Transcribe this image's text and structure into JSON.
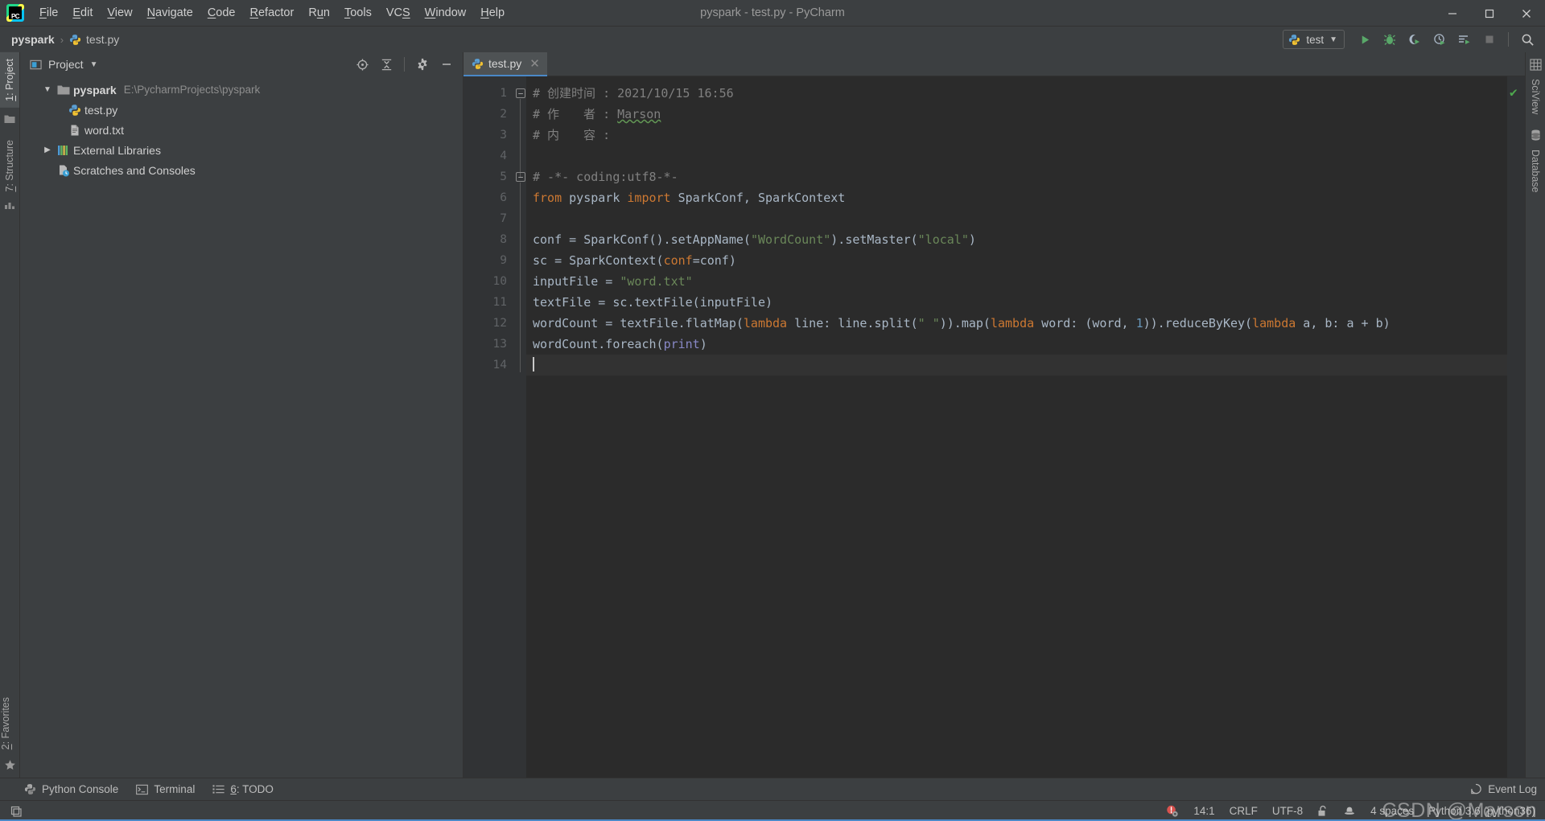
{
  "window": {
    "title": "pyspark - test.py - PyCharm",
    "app_icon": "pycharm-logo-icon",
    "logo_text": "PC",
    "controls": {
      "minimize": "─",
      "maximize": "❐",
      "close": "✕"
    }
  },
  "menubar": {
    "items": [
      {
        "label": "File",
        "mnemonic": "F"
      },
      {
        "label": "Edit",
        "mnemonic": "E"
      },
      {
        "label": "View",
        "mnemonic": "V"
      },
      {
        "label": "Navigate",
        "mnemonic": "N"
      },
      {
        "label": "Code",
        "mnemonic": "C"
      },
      {
        "label": "Refactor",
        "mnemonic": "R"
      },
      {
        "label": "Run",
        "mnemonic": "u"
      },
      {
        "label": "Tools",
        "mnemonic": "T"
      },
      {
        "label": "VCS",
        "mnemonic": "S"
      },
      {
        "label": "Window",
        "mnemonic": "W"
      },
      {
        "label": "Help",
        "mnemonic": "H"
      }
    ]
  },
  "navbar": {
    "breadcrumbs": [
      {
        "label": "pyspark",
        "icon": ""
      },
      {
        "label": "test.py",
        "icon": "python-file-icon"
      }
    ],
    "separator": "›",
    "run_config": {
      "label": "test",
      "icon": "python-config-icon",
      "dropdown": "▾"
    },
    "buttons": [
      {
        "name": "run-button",
        "icon": "run-triangle-icon",
        "color": "#59a869"
      },
      {
        "name": "debug-button",
        "icon": "debug-bug-icon",
        "color": "#59a869"
      },
      {
        "name": "run-with-coverage-button",
        "icon": "coverage-icon",
        "color": "#59a869"
      },
      {
        "name": "profile-button",
        "icon": "profiler-clock-icon",
        "color": "#59a869"
      },
      {
        "name": "run-with-console-button",
        "icon": "run-list-icon",
        "color": "#59a869"
      },
      {
        "name": "stop-button",
        "icon": "stop-square-icon",
        "color": "#6e6e6e"
      },
      {
        "name": "search-everywhere-button",
        "icon": "search-icon",
        "color": "#c4c4c4"
      }
    ]
  },
  "left_strip": {
    "tabs": [
      {
        "label": "1: Project",
        "mnemonic": "1",
        "icon": "project-folder-icon",
        "active": true
      },
      {
        "label": "7: Structure",
        "mnemonic": "7",
        "icon": "structure-icon",
        "active": false
      }
    ],
    "bottom_tabs": [
      {
        "label": "2: Favorites",
        "mnemonic": "2",
        "icon": "star-icon",
        "active": false
      }
    ]
  },
  "right_strip": {
    "tabs": [
      {
        "label": "SciView",
        "icon": "grid-table-icon"
      },
      {
        "label": "Database",
        "icon": "database-cylinder-icon"
      }
    ]
  },
  "project_panel": {
    "title": "Project",
    "dropdown": "▾",
    "view_icon": "project-view-icon",
    "toolbar": [
      {
        "name": "select-opened-file-button",
        "icon": "crosshair-target-icon"
      },
      {
        "name": "collapse-all-button",
        "icon": "collapse-all-icon"
      },
      {
        "name": "settings-button",
        "icon": "gear-icon"
      },
      {
        "name": "hide-button",
        "icon": "minimize-dash-icon"
      }
    ],
    "tree": [
      {
        "label": "pyspark",
        "secondary": "E:\\PycharmProjects\\pyspark",
        "icon": "folder-icon",
        "arrow": "▾",
        "indent": 1,
        "bold": true
      },
      {
        "label": "test.py",
        "secondary": "",
        "icon": "python-file-icon",
        "arrow": "",
        "indent": 2,
        "bold": false
      },
      {
        "label": "word.txt",
        "secondary": "",
        "icon": "text-file-icon",
        "arrow": "",
        "indent": 2,
        "bold": false
      },
      {
        "label": "External Libraries",
        "secondary": "",
        "icon": "libraries-icon",
        "arrow": "▸",
        "indent": 1,
        "bold": false
      },
      {
        "label": "Scratches and Consoles",
        "secondary": "",
        "icon": "scratches-icon",
        "arrow": "",
        "indent": 1,
        "bold": false
      }
    ]
  },
  "editor": {
    "tabs": [
      {
        "label": "test.py",
        "icon": "python-file-icon",
        "close": "✕",
        "active": true
      }
    ],
    "inspection_status": "✔",
    "line_numbers": [
      1,
      2,
      3,
      4,
      5,
      6,
      7,
      8,
      9,
      10,
      11,
      12,
      13,
      14
    ],
    "lines": [
      {
        "n": 1,
        "tokens": [
          {
            "t": "# 创建时间 : 2021/10/15 16:56",
            "c": "cm"
          }
        ]
      },
      {
        "n": 2,
        "tokens": [
          {
            "t": "# 作　　者 : ",
            "c": "cm"
          },
          {
            "t": "Marson",
            "c": "cm typo"
          }
        ]
      },
      {
        "n": 3,
        "tokens": [
          {
            "t": "# 内　　容 :",
            "c": "cm"
          }
        ]
      },
      {
        "n": 4,
        "tokens": []
      },
      {
        "n": 5,
        "tokens": [
          {
            "t": "# -*- coding:utf8-*-",
            "c": "cm"
          }
        ]
      },
      {
        "n": 6,
        "tokens": [
          {
            "t": "from",
            "c": "kw"
          },
          {
            "t": " pyspark ",
            "c": "txt"
          },
          {
            "t": "import",
            "c": "kw"
          },
          {
            "t": " SparkConf, SparkContext",
            "c": "txt"
          }
        ]
      },
      {
        "n": 7,
        "tokens": []
      },
      {
        "n": 8,
        "tokens": [
          {
            "t": "conf = SparkConf().setAppName(",
            "c": "txt"
          },
          {
            "t": "\"WordCount\"",
            "c": "str"
          },
          {
            "t": ").setMaster(",
            "c": "txt"
          },
          {
            "t": "\"local\"",
            "c": "str"
          },
          {
            "t": ")",
            "c": "txt"
          }
        ]
      },
      {
        "n": 9,
        "tokens": [
          {
            "t": "sc = SparkContext(",
            "c": "txt"
          },
          {
            "t": "conf",
            "c": "kw"
          },
          {
            "t": "=conf)",
            "c": "txt"
          }
        ]
      },
      {
        "n": 10,
        "tokens": [
          {
            "t": "inputFile = ",
            "c": "txt"
          },
          {
            "t": "\"word.txt\"",
            "c": "str"
          }
        ]
      },
      {
        "n": 11,
        "tokens": [
          {
            "t": "textFile = sc.textFile(inputFile)",
            "c": "txt"
          }
        ]
      },
      {
        "n": 12,
        "tokens": [
          {
            "t": "wordCount = textFile.flatMap(",
            "c": "txt"
          },
          {
            "t": "lambda",
            "c": "kw"
          },
          {
            "t": " line: line.split(",
            "c": "txt"
          },
          {
            "t": "\" \"",
            "c": "str"
          },
          {
            "t": ")).map(",
            "c": "txt"
          },
          {
            "t": "lambda",
            "c": "kw"
          },
          {
            "t": " word: (word, ",
            "c": "txt"
          },
          {
            "t": "1",
            "c": "num"
          },
          {
            "t": ")).reduceByKey(",
            "c": "txt"
          },
          {
            "t": "lambda",
            "c": "kw"
          },
          {
            "t": " a, b: a + b)",
            "c": "txt"
          }
        ]
      },
      {
        "n": 13,
        "tokens": [
          {
            "t": "wordCount.foreach(",
            "c": "txt"
          },
          {
            "t": "print",
            "c": "bi"
          },
          {
            "t": ")",
            "c": "txt"
          }
        ]
      },
      {
        "n": 14,
        "tokens": [],
        "caret": true
      }
    ]
  },
  "bottom_bar": {
    "buttons": [
      {
        "label": "Python Console",
        "icon": "python-console-icon",
        "mnemonic": ""
      },
      {
        "label": "Terminal",
        "icon": "terminal-icon",
        "mnemonic": ""
      },
      {
        "label": "6: TODO",
        "icon": "todo-list-icon",
        "mnemonic": "6"
      }
    ],
    "right": {
      "label": "Event Log",
      "icon": "event-log-icon"
    }
  },
  "status_bar": {
    "left_icon": "show-toolwindow-bars-icon",
    "items": [
      {
        "name": "inspection-error-badge",
        "label": "",
        "icon": "error-gear-icon"
      },
      {
        "name": "caret-position",
        "label": "14:1",
        "icon": ""
      },
      {
        "name": "line-separator",
        "label": "CRLF",
        "icon": ""
      },
      {
        "name": "file-encoding",
        "label": "UTF-8",
        "icon": ""
      },
      {
        "name": "lock-status",
        "label": "",
        "icon": "unlock-icon"
      },
      {
        "name": "git-branch",
        "label": "",
        "icon": "hat-icon"
      },
      {
        "name": "indent-size",
        "label": "4 spaces",
        "icon": ""
      },
      {
        "name": "python-interpreter",
        "label": "Python 3.6 (python36)",
        "icon": ""
      }
    ]
  },
  "watermark": {
    "text": "CSDN @Marson"
  },
  "colors": {
    "chrome": "#3c3f41",
    "editor_bg": "#2b2b2b",
    "gutter_bg": "#313335",
    "accent_blue": "#4a88c7",
    "run_green": "#59a869",
    "keyword_orange": "#cc7832",
    "string_green": "#6a8759",
    "number_blue": "#6897bb",
    "builtin_purple": "#8888c6",
    "comment_gray": "#808080",
    "default_text": "#a9b7c6"
  }
}
